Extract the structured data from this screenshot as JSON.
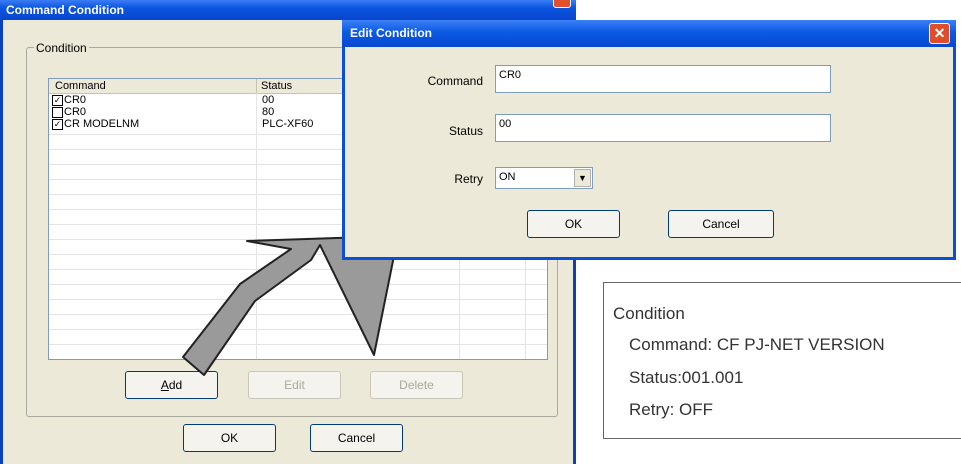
{
  "command_condition": {
    "title": "Command Condition",
    "group_label": "Condition",
    "columns": [
      "Command",
      "Status"
    ],
    "rows": [
      {
        "checked": true,
        "command": "CR0",
        "status": "00"
      },
      {
        "checked": false,
        "command": "CR0",
        "status": "80"
      },
      {
        "checked": true,
        "command": "CR MODELNM",
        "status": "PLC-XF60"
      }
    ],
    "add_label": "Add",
    "edit_label": "Edit",
    "delete_label": "Delete",
    "ok_label": "OK",
    "cancel_label": "Cancel"
  },
  "edit_condition": {
    "title": "Edit Condition",
    "command_label": "Command",
    "command_value": "CR0",
    "status_label": "Status",
    "status_value": "00",
    "retry_label": "Retry",
    "retry_value": "ON",
    "ok_label": "OK",
    "cancel_label": "Cancel"
  },
  "info_box": {
    "heading": "Condition",
    "command_line": "Command: CF PJ-NET VERSION",
    "status_line": "Status:001.001",
    "retry_line": "Retry: OFF"
  },
  "colors": {
    "titlebar_blue": "#0a55e0",
    "window_face": "#ece9d8",
    "close_red": "#e14d28",
    "arrow_fill": "#9a9a9a"
  }
}
